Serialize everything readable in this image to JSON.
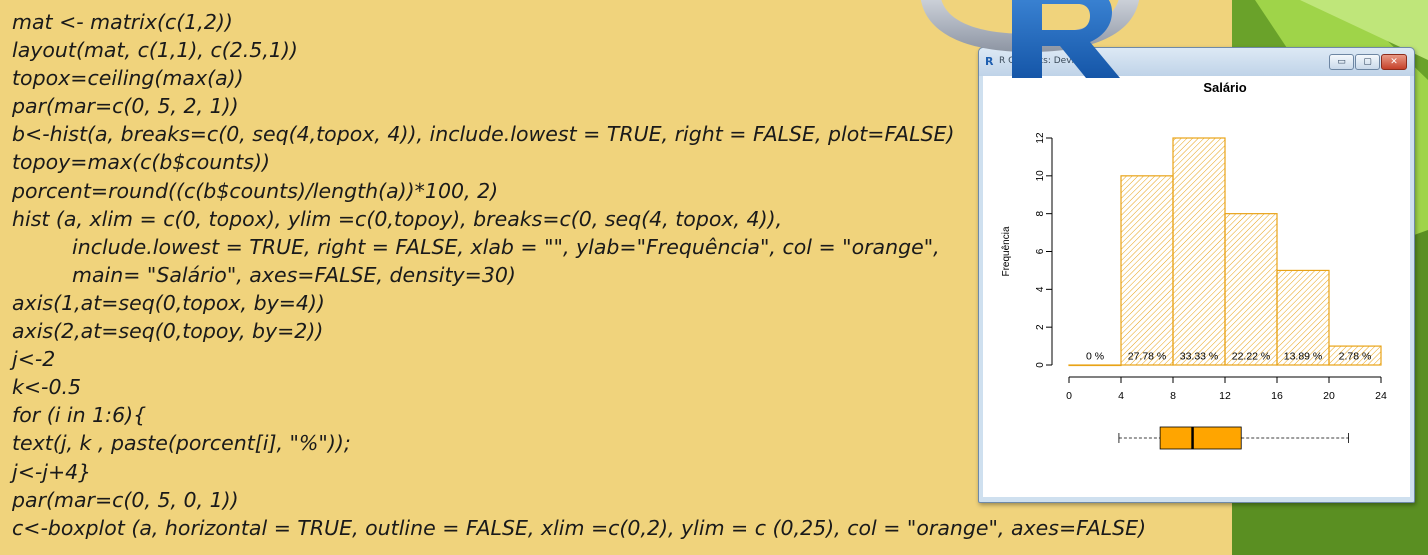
{
  "code_lines": [
    {
      "text": "mat <- matrix(c(1,2))",
      "indent": false
    },
    {
      "text": "layout(mat, c(1,1), c(2.5,1))",
      "indent": false
    },
    {
      "text": "topox=ceiling(max(a))",
      "indent": false
    },
    {
      "text": "par(mar=c(0, 5, 2, 1))",
      "indent": false
    },
    {
      "text": "b<-hist(a, breaks=c(0, seq(4,topox, 4)), include.lowest = TRUE, right = FALSE, plot=FALSE)",
      "indent": false
    },
    {
      "text": "topoy=max(c(b$counts))",
      "indent": false
    },
    {
      "text": "porcent=round((c(b$counts)/length(a))*100, 2)",
      "indent": false
    },
    {
      "text": "hist (a, xlim = c(0, topox), ylim =c(0,topoy), breaks=c(0, seq(4, topox, 4)),",
      "indent": false
    },
    {
      "text": "include.lowest = TRUE, right = FALSE, xlab = \"\", ylab=\"Frequência\", col = \"orange\",",
      "indent": true
    },
    {
      "text": "main= \"Salário\", axes=FALSE, density=30)",
      "indent": true
    },
    {
      "text": "axis(1,at=seq(0,topox, by=4))",
      "indent": false
    },
    {
      "text": "axis(2,at=seq(0,topoy, by=2))",
      "indent": false
    },
    {
      "text": "j<-2",
      "indent": false
    },
    {
      "text": "k<-0.5",
      "indent": false
    },
    {
      "text": "for (i in 1:6){",
      "indent": false
    },
    {
      "text": "text(j, k , paste(porcent[i], \"%\"));",
      "indent": false
    },
    {
      "text": "j<-j+4}",
      "indent": false
    },
    {
      "text": "par(mar=c(0, 5, 0, 1))",
      "indent": false
    },
    {
      "text": "c<-boxplot (a, horizontal = TRUE, outline = FALSE, xlim =c(0,2), ylim = c (0,25), col = \"orange\", axes=FALSE)",
      "indent": false
    }
  ],
  "r_window": {
    "title": "R Graphics: Device 2",
    "buttons": {
      "minimize": "▭",
      "maximize": "▢",
      "close": "✕"
    }
  },
  "colors": {
    "background": "#f0d37c",
    "accent_green": "#6fae2a",
    "orange": "#ffa500",
    "bar_stroke": "#e8a317"
  },
  "chart_data": {
    "type": "bar",
    "title": "Salário",
    "ylabel": "Frequência",
    "xlabel": "",
    "bins": [
      [
        0,
        4
      ],
      [
        4,
        8
      ],
      [
        8,
        12
      ],
      [
        12,
        16
      ],
      [
        16,
        20
      ],
      [
        20,
        24
      ]
    ],
    "counts": [
      0,
      10,
      12,
      8,
      5,
      1
    ],
    "labels": [
      "0 %",
      "27.78 %",
      "33.33 %",
      "22.22 %",
      "13.89 %",
      "2.78 %"
    ],
    "x_ticks": [
      0,
      4,
      8,
      12,
      16,
      20,
      24
    ],
    "y_ticks": [
      0,
      2,
      4,
      6,
      8,
      10,
      12
    ],
    "xlim": [
      0,
      24
    ],
    "ylim": [
      0,
      12
    ],
    "fill": "density-hatch orange",
    "boxplot": {
      "min": 4,
      "q1": 7.3,
      "median": 9.9,
      "q3": 13.8,
      "max": 22.4,
      "range": [
        0,
        25
      ],
      "color": "#ffa500"
    }
  }
}
